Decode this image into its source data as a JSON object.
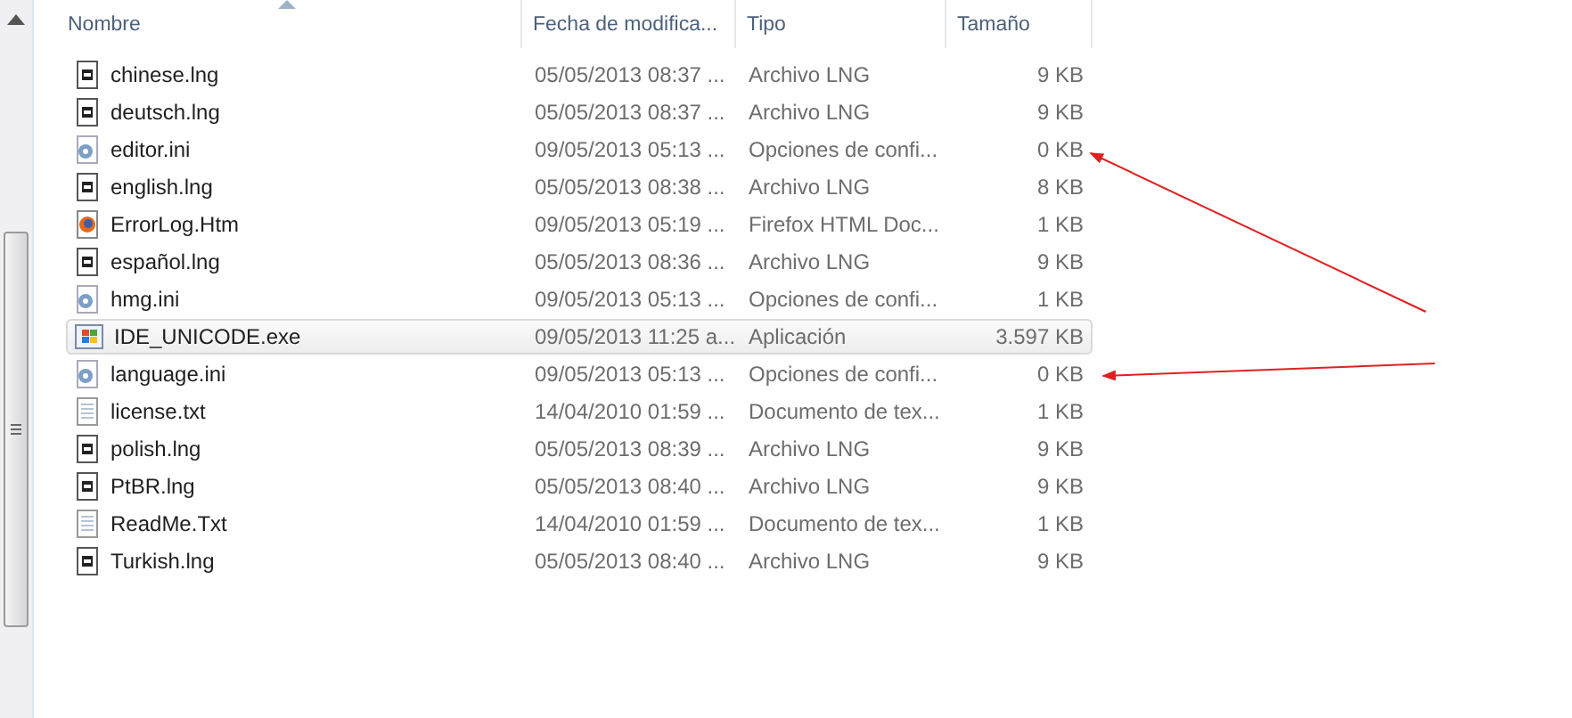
{
  "columns": [
    {
      "label": "Nombre",
      "sorted": true
    },
    {
      "label": "Fecha de modifica...",
      "sorted": false
    },
    {
      "label": "Tipo",
      "sorted": false
    },
    {
      "label": "Tamaño",
      "sorted": false
    }
  ],
  "rows": [
    {
      "kind": "lng",
      "name": "chinese.lng",
      "date": "05/05/2013 08:37 ...",
      "type": "Archivo LNG",
      "size": "9 KB",
      "selected": false
    },
    {
      "kind": "lng",
      "name": "deutsch.lng",
      "date": "05/05/2013 08:37 ...",
      "type": "Archivo LNG",
      "size": "9 KB",
      "selected": false
    },
    {
      "kind": "ini",
      "name": "editor.ini",
      "date": "09/05/2013 05:13 ...",
      "type": "Opciones de confi...",
      "size": "0 KB",
      "selected": false
    },
    {
      "kind": "lng",
      "name": "english.lng",
      "date": "05/05/2013 08:38 ...",
      "type": "Archivo LNG",
      "size": "8 KB",
      "selected": false
    },
    {
      "kind": "htm",
      "name": "ErrorLog.Htm",
      "date": "09/05/2013 05:19 ...",
      "type": "Firefox HTML Doc...",
      "size": "1 KB",
      "selected": false
    },
    {
      "kind": "lng",
      "name": "español.lng",
      "date": "05/05/2013 08:36 ...",
      "type": "Archivo LNG",
      "size": "9 KB",
      "selected": false
    },
    {
      "kind": "ini",
      "name": "hmg.ini",
      "date": "09/05/2013 05:13 ...",
      "type": "Opciones de confi...",
      "size": "1 KB",
      "selected": false
    },
    {
      "kind": "exe",
      "name": "IDE_UNICODE.exe",
      "date": "09/05/2013 11:25 a...",
      "type": "Aplicación",
      "size": "3.597 KB",
      "selected": true
    },
    {
      "kind": "ini",
      "name": "language.ini",
      "date": "09/05/2013 05:13 ...",
      "type": "Opciones de confi...",
      "size": "0 KB",
      "selected": false
    },
    {
      "kind": "txt",
      "name": "license.txt",
      "date": "14/04/2010 01:59 ...",
      "type": "Documento de tex...",
      "size": "1 KB",
      "selected": false
    },
    {
      "kind": "lng",
      "name": "polish.lng",
      "date": "05/05/2013 08:39 ...",
      "type": "Archivo LNG",
      "size": "9 KB",
      "selected": false
    },
    {
      "kind": "lng",
      "name": "PtBR.lng",
      "date": "05/05/2013 08:40 ...",
      "type": "Archivo LNG",
      "size": "9 KB",
      "selected": false
    },
    {
      "kind": "txt",
      "name": "ReadMe.Txt",
      "date": "14/04/2010 01:59 ...",
      "type": "Documento de tex...",
      "size": "1 KB",
      "selected": false
    },
    {
      "kind": "lng",
      "name": "Turkish.lng",
      "date": "05/05/2013 08:40 ...",
      "type": "Archivo LNG",
      "size": "9 KB",
      "selected": false
    }
  ]
}
